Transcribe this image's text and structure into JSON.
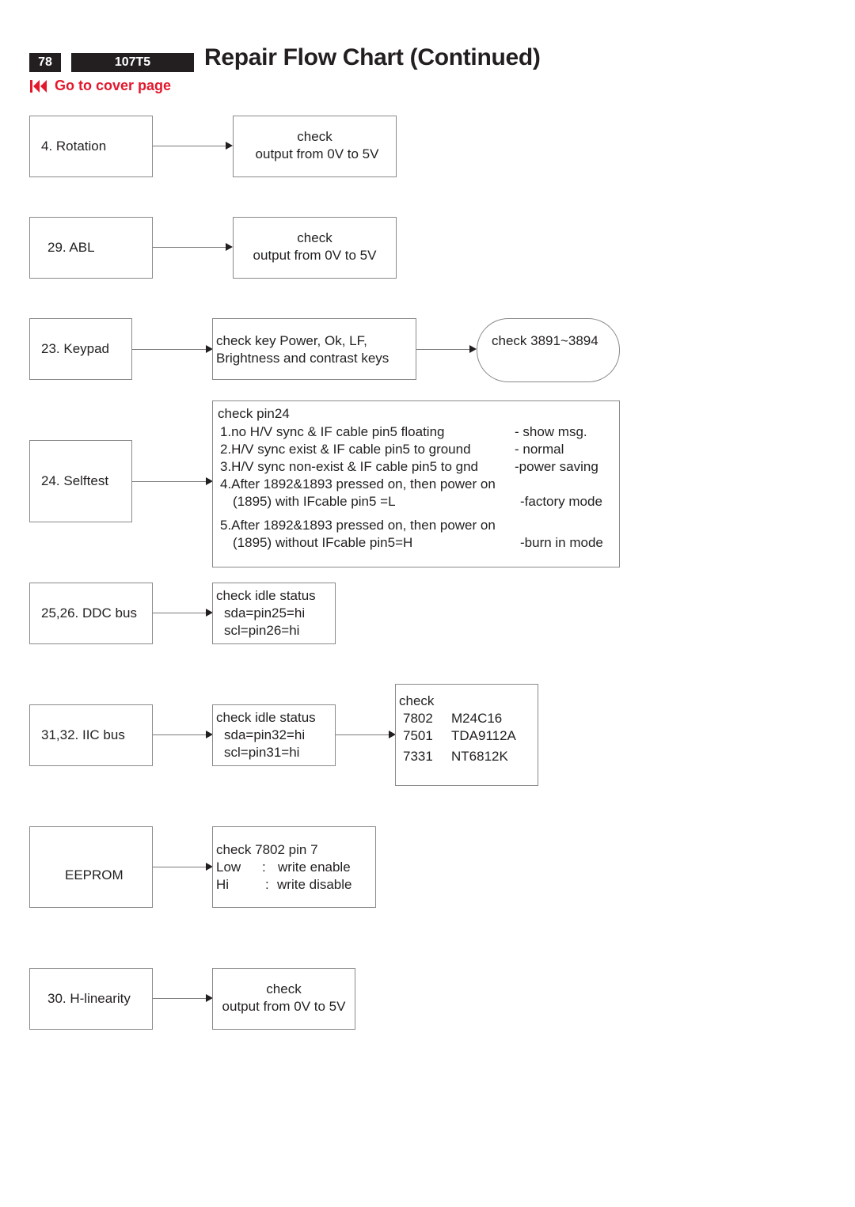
{
  "header": {
    "page_number": "78",
    "model": "107T5",
    "title": "Repair Flow Chart (Continued)",
    "cover_link": "Go to cover page",
    "cover_icon": "skip-to-start-icon",
    "accent_color": "#e3182d"
  },
  "flows": {
    "rotation": {
      "source": "4. Rotation",
      "check_line1": "check",
      "check_line2": "output from 0V to 5V"
    },
    "abl": {
      "source": "29. ABL",
      "check_line1": "check",
      "check_line2": "output from 0V to 5V"
    },
    "keypad": {
      "source": "23. Keypad",
      "check_line1": "check key  Power, Ok, LF,",
      "check_line2": "Brightness and contrast keys",
      "next": "check 3891~3894"
    },
    "selftest": {
      "source": "24. Selftest",
      "heading": "check pin24",
      "items": [
        {
          "cond": "1.no H/V sync & IF cable pin5 floating",
          "result": "- show  msg."
        },
        {
          "cond": "2.H/V sync exist & IF cable pin5 to ground",
          "result": "- normal"
        },
        {
          "cond": "3.H/V sync non-exist & IF cable pin5 to gnd",
          "result": "-power saving"
        },
        {
          "cond": "4.After 1892&1893 pressed on, then power on",
          "cond2": "(1895) with IFcable pin5 =L",
          "result": "-factory mode"
        },
        {
          "cond": "5.After 1892&1893 pressed on, then power on",
          "cond2": "(1895) without IFcable pin5=H",
          "result": "-burn in mode"
        }
      ]
    },
    "ddc": {
      "source": "25,26. DDC bus",
      "lines": [
        "check idle status",
        "sda=pin25=hi",
        "scl=pin26=hi"
      ]
    },
    "iic": {
      "source": "31,32. IIC bus",
      "lines": [
        "check idle status",
        "sda=pin32=hi",
        "scl=pin31=hi"
      ],
      "next_heading": "check",
      "parts": [
        {
          "ref": "7802",
          "ic": "M24C16"
        },
        {
          "ref": "7501",
          "ic": "TDA9112A"
        },
        {
          "ref": "7331",
          "ic": "NT6812K"
        }
      ]
    },
    "eeprom": {
      "source": "EEPROM",
      "heading": "check   7802 pin 7",
      "rows": [
        {
          "level": "Low",
          "sep": ":",
          "meaning": "write enable"
        },
        {
          "level": "Hi",
          "sep": ":",
          "meaning": "write disable"
        }
      ]
    },
    "hlin": {
      "source": "30. H-linearity",
      "check_line1": "check",
      "check_line2": "output from 0V to 5V"
    }
  }
}
